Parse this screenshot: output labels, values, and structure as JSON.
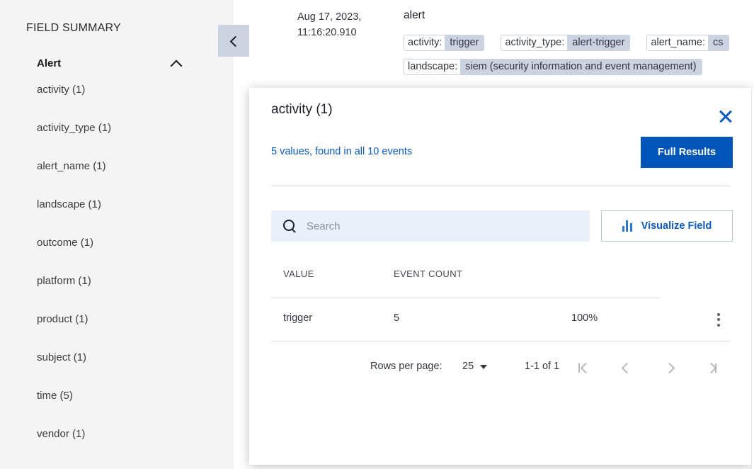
{
  "sidebar": {
    "title": "FIELD SUMMARY",
    "section": {
      "label": "Alert",
      "chevron": "chevron-up-icon",
      "expanded": true
    },
    "fields": [
      {
        "name": "activity",
        "count": "(1)",
        "label": "activity (1)"
      },
      {
        "name": "activity_type",
        "count": "(1)",
        "label": "activity_type (1)"
      },
      {
        "name": "alert_name",
        "count": "(1)",
        "label": "alert_name (1)"
      },
      {
        "name": "landscape",
        "count": "(1)",
        "label": "landscape (1)"
      },
      {
        "name": "outcome",
        "count": "(1)",
        "label": "outcome (1)"
      },
      {
        "name": "platform",
        "count": "(1)",
        "label": "platform (1)"
      },
      {
        "name": "product",
        "count": "(1)",
        "label": "product (1)"
      },
      {
        "name": "subject",
        "count": "(1)",
        "label": "subject (1)"
      },
      {
        "name": "time",
        "count": "(5)",
        "label": "time (5)"
      },
      {
        "name": "vendor",
        "count": "(1)",
        "label": "vendor (1)"
      }
    ]
  },
  "collapse_toggle": {
    "icon": "chevron-left-icon"
  },
  "document": {
    "timestamp": "Aug 17, 2023, 11:16:20.910",
    "title": "alert",
    "tags_row_1": [
      {
        "key": "activity:",
        "value": "trigger"
      },
      {
        "key": "activity_type:",
        "value": "alert-trigger"
      },
      {
        "key": "alert_name:",
        "value": "cs"
      }
    ],
    "tags_row_2": [
      {
        "key": "landscape:",
        "value": "siem (security information and event management)"
      }
    ]
  },
  "modal": {
    "title": "activity (1)",
    "close_icon": "close-icon",
    "summary_link": "5 values, found in all 10 events",
    "full_results_label": "Full Results",
    "search": {
      "placeholder": "Search",
      "value": "",
      "icon": "search-icon"
    },
    "visualize": {
      "label": "Visualize Field",
      "icon": "bar-chart-icon"
    },
    "table": {
      "columns": [
        "VALUE",
        "EVENT COUNT",
        ""
      ],
      "rows": [
        {
          "value": "trigger",
          "event_count": "5",
          "percent": "100%",
          "menu_icon": "kebab-menu-icon"
        }
      ]
    },
    "pagination": {
      "rows_per_page_label": "Rows per page:",
      "rows_per_page_value": "25",
      "range": "1-1 of 1",
      "first_icon": "first-page-icon",
      "prev_icon": "previous-page-icon",
      "next_icon": "next-page-icon",
      "last_icon": "last-page-icon"
    }
  },
  "colors": {
    "accent_blue": "#0055b8",
    "link_blue": "#0a5bc4",
    "sidebar_bg": "#f4f4f4",
    "tag_value_bg": "#ccd3e0",
    "search_bg": "#e8f0fa"
  }
}
